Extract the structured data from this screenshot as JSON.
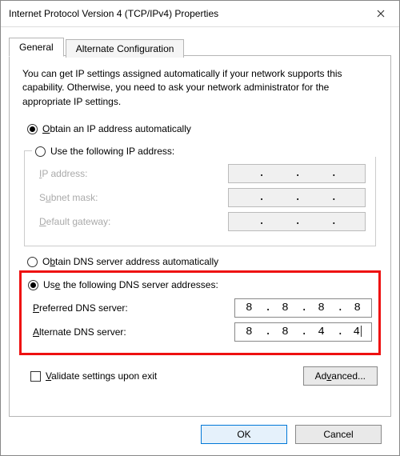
{
  "window": {
    "title": "Internet Protocol Version 4 (TCP/IPv4) Properties"
  },
  "tabs": {
    "general": "General",
    "alt": "Alternate Configuration"
  },
  "description": "You can get IP settings assigned automatically if your network supports this capability. Otherwise, you need to ask your network administrator for the appropriate IP settings.",
  "ip": {
    "auto_prefix": "O",
    "auto_rest": "btain an IP address automatically",
    "manual_prefix": "U",
    "manual_before": "se the following IP address:",
    "addr_u": "I",
    "addr_rest": "P address:",
    "mask_u": "u",
    "mask_before": "S",
    "mask_after": "bnet mask:",
    "gw_u": "D",
    "gw_rest": "efault gateway:"
  },
  "dns": {
    "auto_u": "b",
    "auto_before": "O",
    "auto_after": "tain DNS server address automatically",
    "manual_u": "e",
    "manual_before": "Us",
    "manual_after": " the following DNS server addresses:",
    "pref_u": "P",
    "pref_rest": "referred DNS server:",
    "alt_u": "A",
    "alt_rest": "lternate DNS server:",
    "pref_val": {
      "a": "8",
      "b": "8",
      "c": "8",
      "d": "8"
    },
    "alt_val": {
      "a": "8",
      "b": "8",
      "c": "4",
      "d": "4"
    },
    "dot": "."
  },
  "validate_u": "V",
  "validate_rest": "alidate settings upon exit",
  "advanced_u": "v",
  "advanced_before": "Ad",
  "advanced_after": "anced...",
  "buttons": {
    "ok": "OK",
    "cancel": "Cancel"
  }
}
